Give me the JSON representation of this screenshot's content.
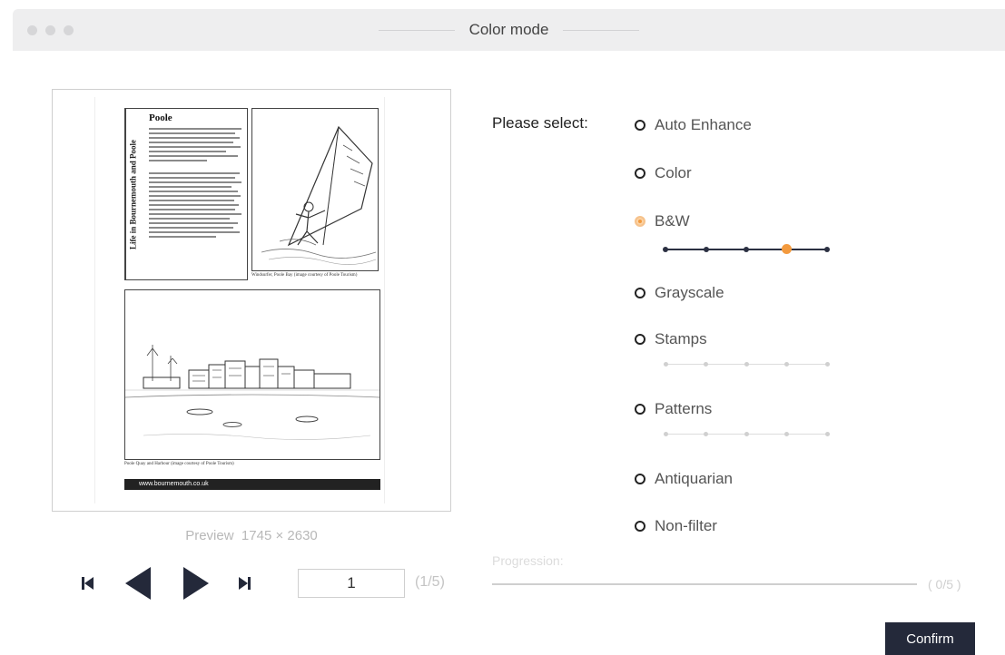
{
  "window": {
    "title": "Color mode"
  },
  "preview": {
    "label": "Preview",
    "dimensions": "1745 × 2630",
    "page_value": "1",
    "page_count": "(1/5)",
    "document": {
      "sidebar_title": "Life in Bournemouth and Poole",
      "heading": "Poole",
      "caption_top": "Windsurfer, Poole Bay (image courtesy of Poole Tourism)",
      "caption_bottom": "Poole Quay and Harbour (image courtesy of Poole Tourism)",
      "url": "www.bournemouth.co.uk"
    }
  },
  "options": {
    "prompt": "Please select:",
    "items": [
      {
        "label": "Auto Enhance",
        "selected": false
      },
      {
        "label": "Color",
        "selected": false
      },
      {
        "label": "B&W",
        "selected": true
      },
      {
        "label": "Grayscale",
        "selected": false
      },
      {
        "label": "Stamps",
        "selected": false
      },
      {
        "label": "Patterns",
        "selected": false
      },
      {
        "label": "Antiquarian",
        "selected": false
      },
      {
        "label": "Non-filter",
        "selected": false
      }
    ],
    "bw_level": {
      "value": 4,
      "of": 5
    },
    "stamps_level": {
      "of": 5
    },
    "patterns_level": {
      "of": 5
    }
  },
  "progress": {
    "label": "Progression:",
    "count": "( 0/5 )",
    "value": 0
  },
  "actions": {
    "confirm_label": "Confirm"
  },
  "colors": {
    "accent": "#f39a3e",
    "primary_dark": "#24293a"
  }
}
